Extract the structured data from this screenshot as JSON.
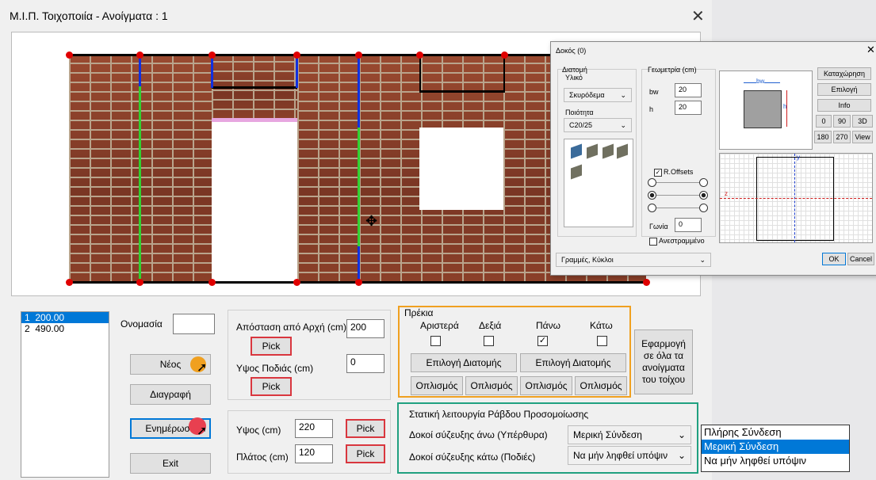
{
  "window": {
    "title": "Μ.Ι.Π. Τοιχοποιία - Ανοίγματα : 1"
  },
  "openings_list": [
    {
      "index": "1",
      "value": "200.00"
    },
    {
      "index": "2",
      "value": "490.00"
    }
  ],
  "naming": {
    "label": "Ονομασία",
    "value": ""
  },
  "buttons": {
    "new": "Νέος",
    "delete": "Διαγραφή",
    "update": "Ενημέρωση",
    "exit": "Exit",
    "pick": "Pick",
    "apply_all": "Εφαρμογή σε όλα τα ανοίγματα του τοίχου"
  },
  "position": {
    "distance_label": "Απόσταση από Αρχή (cm)",
    "distance_value": "200",
    "sill_label": "Υψος Ποδιάς (cm)",
    "sill_value": "0"
  },
  "size": {
    "height_label": "Υψος  (cm)",
    "height_value": "220",
    "width_label": "Πλάτος (cm)",
    "width_value": "120"
  },
  "lintel": {
    "title": "Πρέκια",
    "cols": [
      "Αριστερά",
      "Δεξιά",
      "Πάνω",
      "Κάτω"
    ],
    "checked": [
      false,
      false,
      true,
      false
    ],
    "section_button": "Επιλογή Διατομής",
    "reinf_button": "Οπλισμός"
  },
  "static": {
    "title": "Στατική λειτουργία Ράβδου Προσομοίωσης",
    "upper_label": "Δοκοί σύζευξης άνω (Υπέρθυρα)",
    "upper_value": "Μερική Σύνδεση",
    "lower_label": "Δοκοί σύζευξης κάτω (Ποδιές)",
    "lower_value": "Να μήν ληφθεί υπόψιν"
  },
  "dropdown_options": [
    "Πλήρης Σύνδεση",
    "Μερική Σύνδεση",
    "Να μήν ληφθεί υπόψιν"
  ],
  "dropdown_selected_index": 1,
  "beam_dialog": {
    "title": "Δοκός (0)",
    "section_group": "Διατομή",
    "material_label": "Υλικό",
    "material_value": "Σκυρόδεμα",
    "quality_label": "Ποιότητα",
    "quality_value": "C20/25",
    "geometry_label": "Γεωμετρία (cm)",
    "bw_label": "bw",
    "bw_value": "20",
    "h_label": "h",
    "h_value": "20",
    "roffsets_label": "R.Offsets",
    "angle_label": "Γωνία",
    "angle_value": "0",
    "inverted_label": "Ανεστραμμένο",
    "lines_select": "Γραμμές, Κύκλοι",
    "preview_bw": "bw",
    "preview_h": "h",
    "preview_z": "z",
    "preview_y": "y",
    "side_buttons": {
      "register": "Καταχώρηση",
      "choose": "Επιλογή",
      "info": "Info",
      "r0": "0",
      "r90": "90",
      "r3d": "3D",
      "r180": "180",
      "r270": "270",
      "view": "View"
    },
    "ok": "OK",
    "cancel": "Cancel"
  },
  "colors": {
    "accent_orange": "#f0a020",
    "accent_green": "#20a080",
    "pick_border": "#d9363e",
    "selection_blue": "#0078d7"
  }
}
